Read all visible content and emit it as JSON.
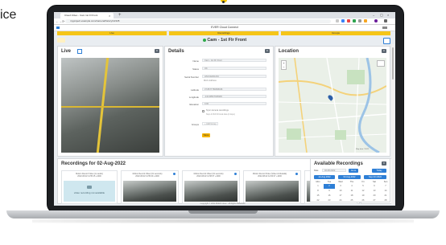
{
  "page": {
    "partial_word": "ice"
  },
  "browser": {
    "tab_title": "Cloud Video - Cam 1st Fl Front",
    "tab_close": "×",
    "new_tab": "+",
    "url": "myproject.example.com/camera/history/12345",
    "window_controls": [
      "–",
      "▢",
      "×"
    ],
    "nav": [
      "←",
      "→",
      "⟳"
    ]
  },
  "app": {
    "title": "EVER Cloud Connect",
    "menu_bar": [
      "Live",
      "Recordings",
      "Groups"
    ]
  },
  "camera": {
    "title": "Cam - 1st Flr Front",
    "status_dot_color": "#2eaa4a",
    "left_btn": "",
    "right_btn": ""
  },
  "live": {
    "title": "Live",
    "menu_icon": "≡"
  },
  "details": {
    "title": "Details",
    "menu_icon": "≡",
    "fields": [
      {
        "label": "Name",
        "value": "Cam - 1st Flr Front"
      },
      {
        "label": "Status",
        "value": "OK"
      },
      {
        "label": "Serial Number",
        "value": "HSCCE001234"
      },
      {
        "label": "",
        "value": "MAC Address"
      },
      {
        "label": "Latitude",
        "value": "37.8677780058436"
      },
      {
        "label": "Longitude",
        "value": "-144.98527926939"
      },
      {
        "label": "Elevation",
        "value": "0.00"
      }
    ],
    "checkbox_note": "Sync camera recordings",
    "checkbox_sub": "Stop & Poll Fill local data (2 days)",
    "groups_label": "Groups",
    "groups_value": "+ Add Group",
    "save_label": "Save"
  },
  "location": {
    "title": "Location",
    "menu_icon": "≡",
    "zoom_in": "+",
    "zoom_out": "−",
    "map_attribution": "Map data ©2022"
  },
  "recordings": {
    "title": "Recordings for 02-Aug-2022",
    "menu_icon": "≡",
    "not_available_text": "video recording not available",
    "cards": [
      {
        "title": "Motion Record Video (no audio)",
        "time": "2022-08-02 11:55:15 +1000"
      },
      {
        "title": "Motion Record Video (01 seconds)",
        "time": "2022-08-02 11:55:49 +1000"
      },
      {
        "title": "Motion Record Video (01 seconds)",
        "time": "2022-08-02 11:58:37 +1000"
      },
      {
        "title": "Motion Record Video (Video & Metadat)",
        "time": "2022-08-02 12:00:07 +1000"
      }
    ]
  },
  "available": {
    "title": "Available Recordings",
    "menu_icon": "≡",
    "date_label": "Date",
    "date_value": "02-08-2022",
    "go_label": "Go to",
    "today_label": "Today",
    "prev_month": "Jul-Aug 2022",
    "current_month": "02-Aug-2022",
    "next_month": "Sep-Oct 2022",
    "weekdays": [
      "Mon",
      "Tue",
      "Wed",
      "Thu",
      "Fri",
      "Sat",
      "Sun"
    ],
    "days": [
      "1",
      "2",
      "3",
      "4",
      "5",
      "6",
      "7",
      "8",
      "9",
      "10",
      "11",
      "12",
      "13",
      "14",
      "15",
      "16",
      "17",
      "18",
      "19",
      "20",
      "21",
      "22",
      "23",
      "24",
      "25",
      "26",
      "27",
      "28"
    ],
    "selected_day": "2",
    "accent_color": "#2e7fd6"
  },
  "footer": {
    "copyright": "Copyright © 2022 EVER Cloud · All Rights Reserved"
  }
}
